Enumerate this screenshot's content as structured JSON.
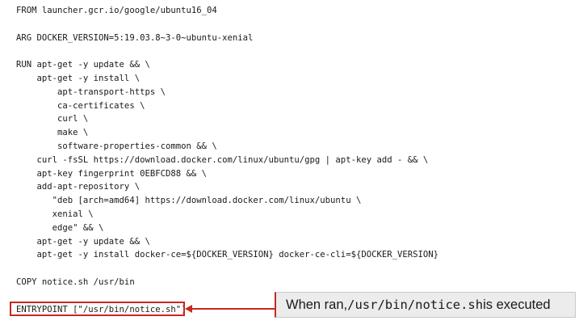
{
  "code": {
    "lines": [
      "FROM launcher.gcr.io/google/ubuntu16_04",
      "",
      "ARG DOCKER_VERSION=5:19.03.8~3-0~ubuntu-xenial",
      "",
      "RUN apt-get -y update && \\",
      "    apt-get -y install \\",
      "        apt-transport-https \\",
      "        ca-certificates \\",
      "        curl \\",
      "        make \\",
      "        software-properties-common && \\",
      "    curl -fsSL https://download.docker.com/linux/ubuntu/gpg | apt-key add - && \\",
      "    apt-key fingerprint 0EBFCD88 && \\",
      "    add-apt-repository \\",
      "       \"deb [arch=amd64] https://download.docker.com/linux/ubuntu \\",
      "       xenial \\",
      "       edge\" && \\",
      "    apt-get -y update && \\",
      "    apt-get -y install docker-ce=${DOCKER_VERSION} docker-ce-cli=${DOCKER_VERSION}",
      "",
      "COPY notice.sh /usr/bin",
      "",
      "ENTRYPOINT [\"/usr/bin/notice.sh\"]"
    ]
  },
  "callout": {
    "prefix": "When ran, ",
    "path": "/usr/bin/notice.sh",
    "suffix": " is executed"
  },
  "colors": {
    "highlight": "#c8281e",
    "callout_background": "#ececec"
  }
}
